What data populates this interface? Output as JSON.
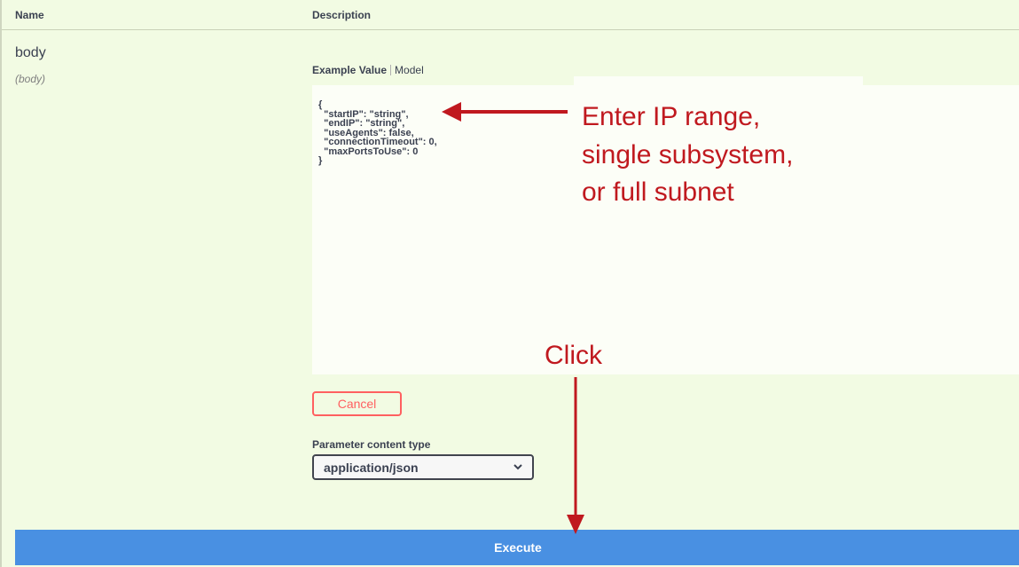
{
  "table": {
    "col_name": "Name",
    "col_description": "Description"
  },
  "parameter": {
    "name": "body",
    "location": "(body)"
  },
  "tabs": {
    "example_value": "Example Value",
    "model": "Model"
  },
  "editor": {
    "code": "{\n  \"startIP\": \"string\",\n  \"endIP\": \"string\",\n  \"useAgents\": false,\n  \"connectionTimeout\": 0,\n  \"maxPortsToUse\": 0\n}"
  },
  "cancel_button": "Cancel",
  "content_type": {
    "label": "Parameter content type",
    "selected": "application/json"
  },
  "execute_button": "Execute",
  "annotations": {
    "ip_line1": "Enter IP range,",
    "ip_line2": "single subsystem,",
    "ip_line3": "or full subnet",
    "click": "Click",
    "color": "#c0191f"
  },
  "colors": {
    "background": "#f2fbe3",
    "execute": "#4990e2",
    "cancel": "#ff6060"
  }
}
